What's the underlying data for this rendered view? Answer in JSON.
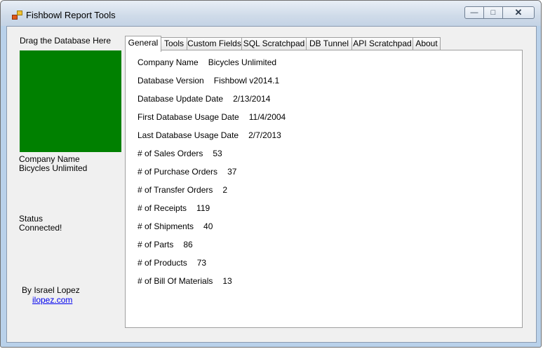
{
  "window": {
    "title": "Fishbowl Report Tools",
    "controls": {
      "minimize": "—",
      "maximize": "□",
      "close": "✕"
    }
  },
  "left": {
    "drop_label": "Drag the Database Here",
    "drop_color": "#008000",
    "company_label": "Company Name",
    "company_value": "Bicycles Unlimited",
    "status_label": "Status",
    "status_value": "Connected!",
    "author": "By Israel Lopez",
    "link": "ilopez.com"
  },
  "tabs": [
    {
      "label": "General"
    },
    {
      "label": "Tools"
    },
    {
      "label": "Custom Fields"
    },
    {
      "label": "SQL Scratchpad"
    },
    {
      "label": "DB Tunnel"
    },
    {
      "label": "API Scratchpad"
    },
    {
      "label": "About"
    }
  ],
  "general": [
    {
      "label": "Company Name",
      "value": "Bicycles Unlimited"
    },
    {
      "label": "Database Version",
      "value": "Fishbowl v2014.1"
    },
    {
      "label": "Database Update Date",
      "value": "2/13/2014"
    },
    {
      "label": "First Database Usage Date",
      "value": "11/4/2004"
    },
    {
      "label": "Last Database Usage Date",
      "value": "2/7/2013"
    },
    {
      "label": "# of Sales Orders",
      "value": "53"
    },
    {
      "label": "# of Purchase Orders",
      "value": "37"
    },
    {
      "label": "# of Transfer Orders",
      "value": "2"
    },
    {
      "label": "# of Receipts",
      "value": "119"
    },
    {
      "label": "# of Shipments",
      "value": "40"
    },
    {
      "label": "# of Parts",
      "value": "86"
    },
    {
      "label": "# of Products",
      "value": "73"
    },
    {
      "label": "# of Bill Of Materials",
      "value": "13"
    }
  ]
}
